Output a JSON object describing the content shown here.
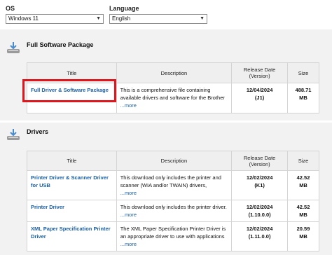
{
  "filters": {
    "os_label": "OS",
    "os_value": "Windows 11",
    "language_label": "Language",
    "language_value": "English"
  },
  "sections": [
    {
      "title": "Full Software Package",
      "headers": {
        "title": "Title",
        "description": "Description",
        "release_date": "Release Date\n(Version)",
        "size": "Size"
      },
      "rows": [
        {
          "title": "Full Driver & Software Package",
          "description": "This is a comprehensive file containing available drivers and software for the Brother",
          "more": "...more",
          "date": "12/04/2024",
          "version": "(J1)",
          "size": "488.71",
          "size_unit": "MB"
        }
      ]
    },
    {
      "title": "Drivers",
      "headers": {
        "title": "Title",
        "description": "Description",
        "release_date": "Release Date\n(Version)",
        "size": "Size"
      },
      "rows": [
        {
          "title": "Printer Driver & Scanner Driver for USB",
          "description": "This download only includes the printer and scanner (WIA and/or TWAIN) drivers,",
          "more": "...more",
          "date": "12/02/2024",
          "version": "(K1)",
          "size": "42.52",
          "size_unit": "MB"
        },
        {
          "title": "Printer Driver",
          "description": "This download only includes the printer driver.",
          "more": "...more",
          "date": "12/02/2024",
          "version": "(1.10.0.0)",
          "size": "42.52",
          "size_unit": "MB"
        },
        {
          "title": "XML Paper Specification Printer Driver",
          "description": "The XML Paper Specification Printer Driver is an appropriate driver to use with applications",
          "more": "...more",
          "date": "12/02/2024",
          "version": "(1.11.0.0)",
          "size": "20.59",
          "size_unit": "MB"
        }
      ]
    }
  ],
  "icons": {
    "section_icon": "download-printer-icon",
    "dropdown": "chevron-down-icon"
  },
  "colors": {
    "link": "#1a5fa8",
    "highlight": "#e0161c",
    "header_bg": "#efefef",
    "band_bg": "#f2f2f2"
  }
}
